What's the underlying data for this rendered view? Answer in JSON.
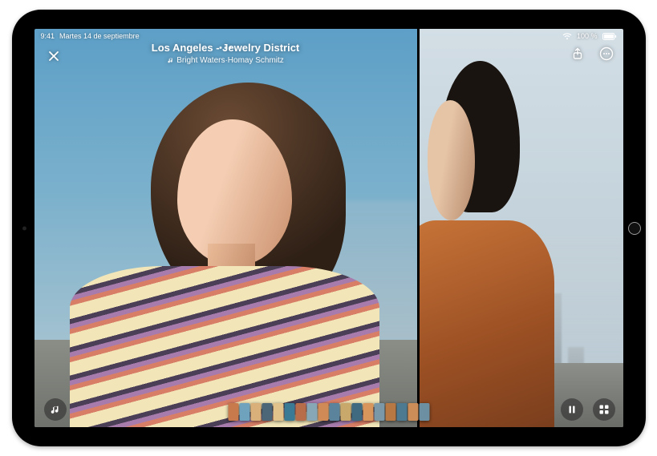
{
  "status": {
    "time": "9:41",
    "date": "Martes 14 de septiembre",
    "battery_text": "100 %"
  },
  "memory": {
    "title": "Los Angeles - Jewelry District",
    "music_label": "Bright Waters·Homay Schmitz"
  },
  "icons": {
    "close": "close-icon",
    "share": "share-icon",
    "more": "more-icon",
    "music": "music-icon",
    "pause": "pause-icon",
    "grid": "grid-icon",
    "wifi": "wifi-icon",
    "battery": "battery-icon",
    "note": "note-icon"
  },
  "thumbnails": [
    {
      "c": "#c97a4c"
    },
    {
      "c": "#6fa2bd"
    },
    {
      "c": "#d9b07a"
    },
    {
      "c": "#4c6678"
    },
    {
      "c": "#e0c28a"
    },
    {
      "c": "#3a7a94"
    },
    {
      "c": "#b76d4a"
    },
    {
      "c": "#87a7b7"
    },
    {
      "c": "#d08a55"
    },
    {
      "c": "#5b849c"
    },
    {
      "c": "#c9a86c"
    },
    {
      "c": "#3f6a80"
    },
    {
      "c": "#d9965c"
    },
    {
      "c": "#7a98a8"
    },
    {
      "c": "#b87844"
    },
    {
      "c": "#4d7a90"
    },
    {
      "c": "#cd8d58"
    },
    {
      "c": "#6c8fa2"
    }
  ]
}
